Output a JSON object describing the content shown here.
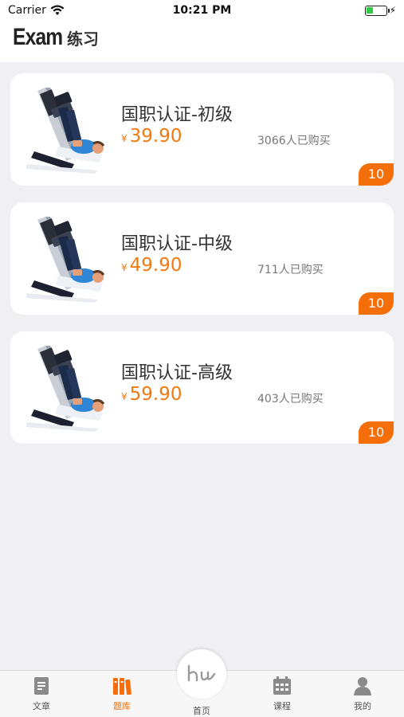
{
  "status_bar": {
    "carrier": "Carrier",
    "time": "10:21 PM",
    "battery_level": 0.35
  },
  "header": {
    "title_en": "Exam",
    "title_zh": "练习"
  },
  "courses": [
    {
      "name": "国职认证-初级",
      "currency": "¥",
      "price": "39.90",
      "sold": "3066人已购买",
      "badge": "10"
    },
    {
      "name": "国职认证-中级",
      "currency": "¥",
      "price": "49.90",
      "sold": "711人已购买",
      "badge": "10"
    },
    {
      "name": "国职认证-高级",
      "currency": "¥",
      "price": "59.90",
      "sold": "403人已购买",
      "badge": "10"
    }
  ],
  "tabbar": {
    "items": [
      {
        "label": "文章",
        "icon": "document-icon"
      },
      {
        "label": "题库",
        "icon": "books-icon"
      },
      {
        "label": "首页",
        "icon": "hu-logo-icon"
      },
      {
        "label": "课程",
        "icon": "calendar-icon"
      },
      {
        "label": "我的",
        "icon": "person-icon"
      }
    ],
    "active_index": 1
  },
  "colors": {
    "accent": "#f46e0a",
    "price": "#f07a12",
    "background": "#efeff4"
  }
}
